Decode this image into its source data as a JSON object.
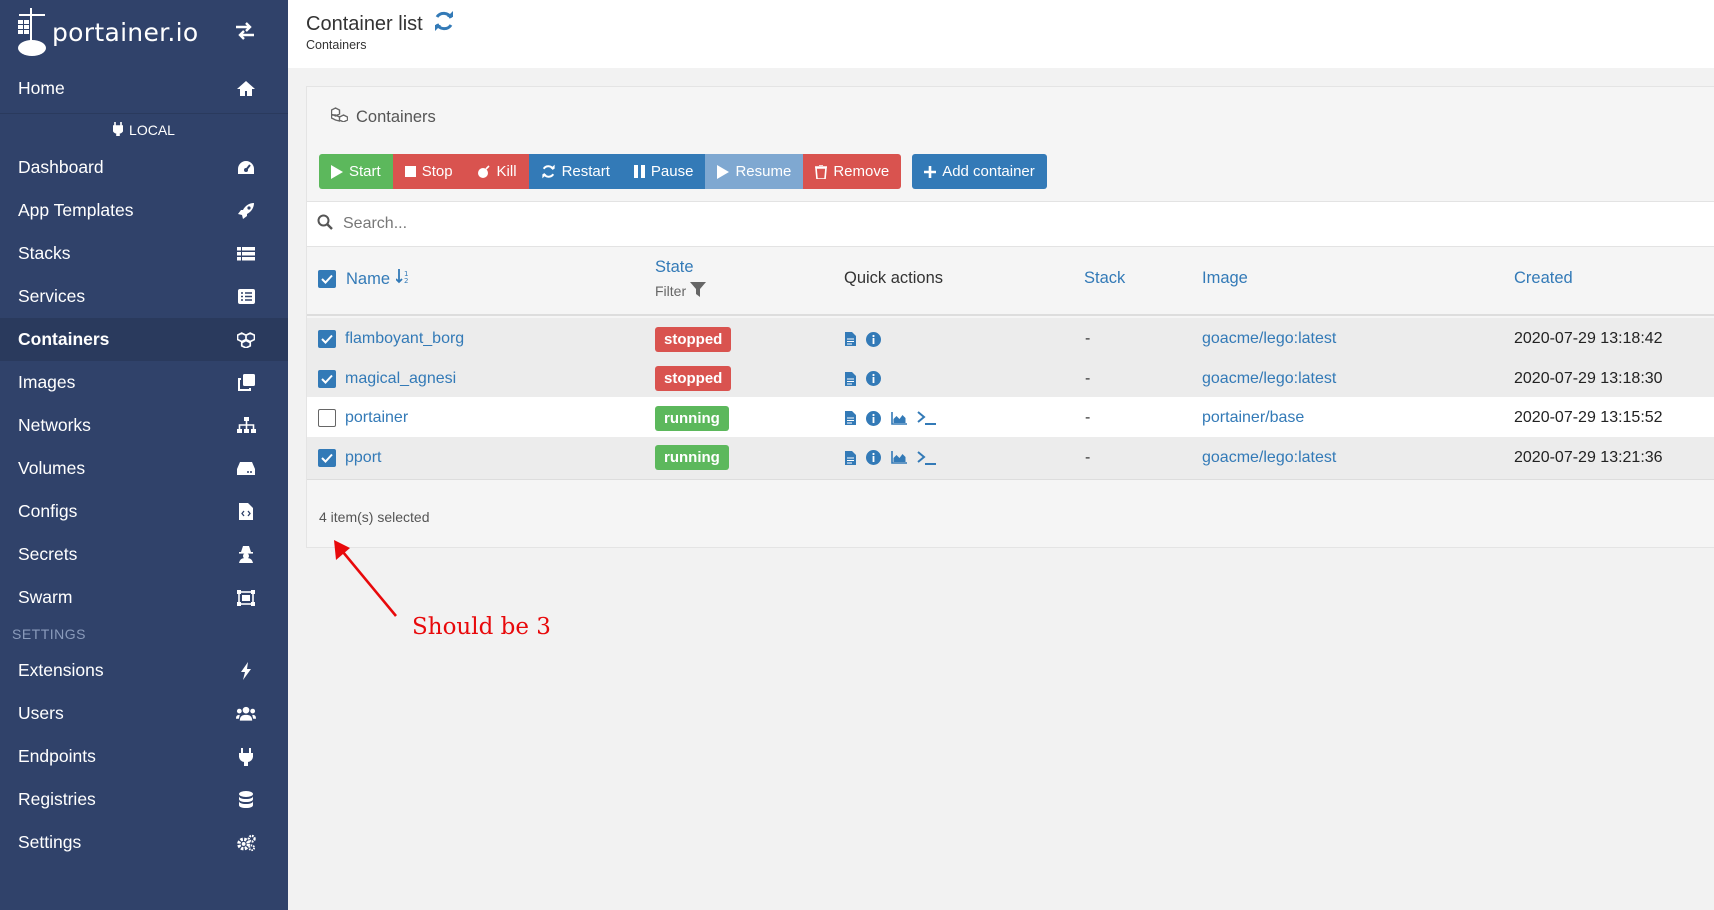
{
  "brand": {
    "name": "portainer.io"
  },
  "sidebar": {
    "home": "Home",
    "environment": "LOCAL",
    "items": [
      {
        "label": "Dashboard",
        "icon": "dashboard-icon"
      },
      {
        "label": "App Templates",
        "icon": "rocket-icon"
      },
      {
        "label": "Stacks",
        "icon": "stacks-icon"
      },
      {
        "label": "Services",
        "icon": "services-icon"
      },
      {
        "label": "Containers",
        "icon": "cubes-icon",
        "active": true
      },
      {
        "label": "Images",
        "icon": "clone-icon"
      },
      {
        "label": "Networks",
        "icon": "sitemap-icon"
      },
      {
        "label": "Volumes",
        "icon": "hdd-icon"
      },
      {
        "label": "Configs",
        "icon": "file-code-icon"
      },
      {
        "label": "Secrets",
        "icon": "user-secret-icon"
      },
      {
        "label": "Swarm",
        "icon": "object-group-icon"
      }
    ],
    "settings_title": "SETTINGS",
    "settings_items": [
      {
        "label": "Extensions",
        "icon": "bolt-icon"
      },
      {
        "label": "Users",
        "icon": "users-icon"
      },
      {
        "label": "Endpoints",
        "icon": "plug-icon"
      },
      {
        "label": "Registries",
        "icon": "database-icon"
      },
      {
        "label": "Settings",
        "icon": "cogs-icon"
      }
    ]
  },
  "header": {
    "title": "Container list",
    "breadcrumb": "Containers"
  },
  "widget": {
    "title": "Containers",
    "buttons": {
      "start": "Start",
      "stop": "Stop",
      "kill": "Kill",
      "restart": "Restart",
      "pause": "Pause",
      "resume": "Resume",
      "remove": "Remove",
      "add": "Add container"
    },
    "search_placeholder": "Search...",
    "columns": {
      "name": "Name",
      "state": "State",
      "state_filter": "Filter",
      "quick_actions": "Quick actions",
      "stack": "Stack",
      "image": "Image",
      "created": "Created"
    },
    "rows": [
      {
        "name": "flamboyant_borg",
        "state": "stopped",
        "stack": "-",
        "image": "goacme/lego:latest",
        "created": "2020-07-29 13:18:42",
        "selected": true
      },
      {
        "name": "magical_agnesi",
        "state": "stopped",
        "stack": "-",
        "image": "goacme/lego:latest",
        "created": "2020-07-29 13:18:30",
        "selected": true
      },
      {
        "name": "portainer",
        "state": "running",
        "stack": "-",
        "image": "portainer/base",
        "created": "2020-07-29 13:15:52",
        "selected": false
      },
      {
        "name": "pport",
        "state": "running",
        "stack": "-",
        "image": "goacme/lego:latest",
        "created": "2020-07-29 13:21:36",
        "selected": true
      }
    ],
    "selected_count": "4 item(s) selected"
  },
  "annotation": {
    "text": "Should be 3",
    "color": "#e8090b"
  },
  "colors": {
    "sidebar": "#30426a",
    "link": "#337ab7",
    "success": "#5cb85c",
    "danger": "#d9534f"
  }
}
